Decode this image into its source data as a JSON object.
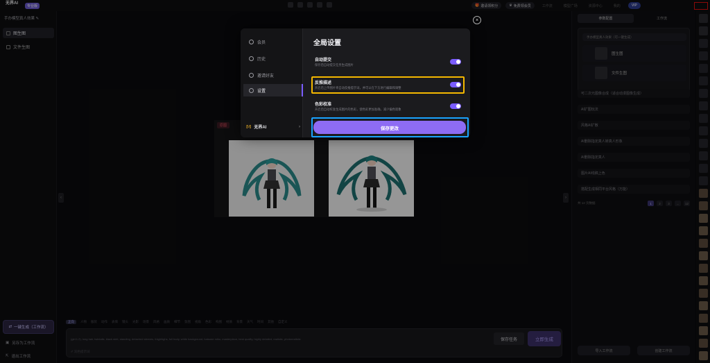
{
  "topbar": {
    "brand_name": "无界AI",
    "brand_badge": "专业版",
    "buttons": [
      "邀请领积分",
      "免费领会员"
    ],
    "dim_items": [
      "工作流",
      "模型广场",
      "资源中心",
      "我的"
    ],
    "user_badge": "VIP"
  },
  "sidebar": {
    "project_name": "手办模型真人效果 ✎",
    "items": [
      "图生图",
      "文件生图"
    ],
    "one_click": "一键生成（工作流）",
    "bottom": [
      "另存为工作流",
      "退出工作流"
    ]
  },
  "canvas": {
    "tag": "原图"
  },
  "prompt": {
    "chips": [
      "正向",
      "人物",
      "服装",
      "动作",
      "表情",
      "镜头",
      "光影",
      "场景",
      "风格",
      "画质",
      "细节",
      "氛围",
      "视角",
      "色彩",
      "构图",
      "材质",
      "背景",
      "天气",
      "时间",
      "其他",
      "自定义"
    ],
    "text": "(girl:1.2), long hair, twintails, black skirt, standing, detached sleeves, thighhighs, full body, white background, hatsune miku, masterpiece, best quality, highly detailed, realistic, photorealistic",
    "sub": "✐ 润色提示词",
    "save_task": "保存任务",
    "generate": "立即生成"
  },
  "rpanel": {
    "tabs": [
      "参数配置",
      "工作流"
    ],
    "select": "手办模型真人效果（可一键生成）",
    "thumb_rows": [
      "图生图",
      "文件生图"
    ],
    "list": [
      "可二次元图像合成（适合动漫图像生成）",
      "AI扩图玩法",
      "风格AI扩散",
      "AI删除指定真人转真人形象",
      "AI删除指定真人",
      "图片AI线稿上色",
      "搭配生成相同平台风格（万能）"
    ],
    "pager_text": "共 12 页数据",
    "pages": [
      "1",
      "2",
      "3",
      "...",
      "12"
    ],
    "btn_left": "导入工作流",
    "btn_right": "创建工作流"
  },
  "modal": {
    "nav": [
      "会员",
      "历史",
      "邀请好友",
      "设置"
    ],
    "nav_brand": "无界AI",
    "title": "全局设置",
    "settings": [
      {
        "label": "自动提交",
        "desc": "保存后自动提交任务生成图片"
      },
      {
        "label": "反推描述",
        "desc": "开启后上传图片将自动反推提示词，并可以在下方进行编辑和调整"
      },
      {
        "label": "色彩校准",
        "desc": "开启后自动校准生成图片的色彩，使色彩更加准确，减少偏色现象"
      }
    ],
    "save": "保存更改",
    "close": "×"
  },
  "colors": {
    "accent": "#8e6cf4",
    "highlight_yellow": "#f5b800",
    "highlight_blue": "#1aa3ff",
    "highlight_red": "#e01010"
  }
}
